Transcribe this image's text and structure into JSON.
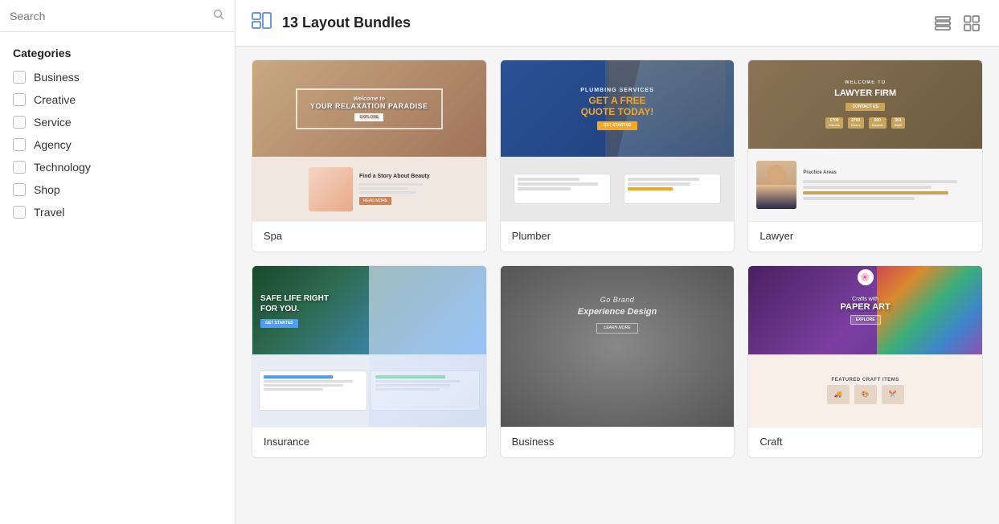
{
  "sidebar": {
    "search_placeholder": "Search",
    "categories_title": "Categories",
    "categories": [
      {
        "id": "business",
        "label": "Business",
        "checked": false
      },
      {
        "id": "creative",
        "label": "Creative",
        "checked": false
      },
      {
        "id": "service",
        "label": "Service",
        "checked": false
      },
      {
        "id": "agency",
        "label": "Agency",
        "checked": false
      },
      {
        "id": "technology",
        "label": "Technology",
        "checked": false
      },
      {
        "id": "shop",
        "label": "Shop",
        "checked": false
      },
      {
        "id": "travel",
        "label": "Travel",
        "checked": false
      }
    ]
  },
  "header": {
    "bundle_count": "13",
    "title": "Layout Bundles",
    "icon_label": "layout-bundles-icon"
  },
  "templates": [
    {
      "id": "spa",
      "label": "Spa"
    },
    {
      "id": "plumber",
      "label": "Plumber"
    },
    {
      "id": "lawyer",
      "label": "Lawyer"
    },
    {
      "id": "insurance",
      "label": "Insurance"
    },
    {
      "id": "business",
      "label": "Business"
    },
    {
      "id": "craft",
      "label": "Craft"
    }
  ],
  "view_icons": {
    "list_view_label": "List view",
    "grid_view_label": "Grid view"
  },
  "spa": {
    "welcome_text": "Welcome to",
    "subtitle": "YOUR RELAXATION PARADISE",
    "story_text": "Find a Story About Beauty"
  },
  "plumber": {
    "line1": "PLUMBING SERVICES",
    "line2": "GET A FREE",
    "line3": "QUOTE TODAY!"
  },
  "lawyer": {
    "line1": "WELCOME TO",
    "line2": "LAWYER FIRM",
    "stats": [
      "1700",
      "2700",
      "500",
      "301"
    ]
  },
  "insurance": {
    "line1": "SAFE LIFE RIGHT",
    "line2": "FOR YOU."
  },
  "business_card": {
    "line1": "Go Brand",
    "line2": "Experience Design"
  },
  "craft": {
    "line1": "Crafts with",
    "line2": "PAPER ART"
  }
}
